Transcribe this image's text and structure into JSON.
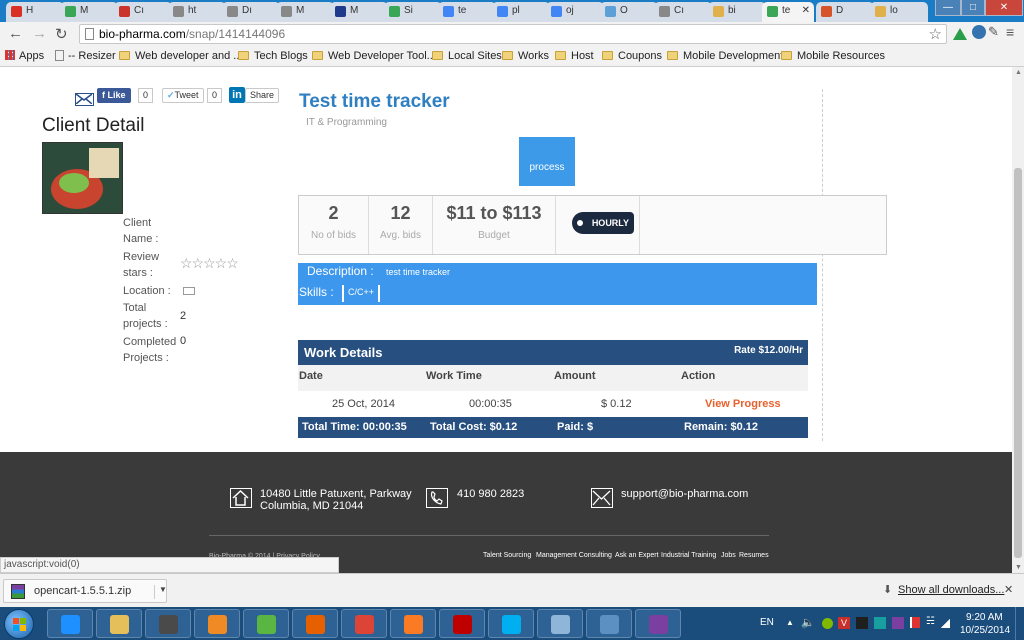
{
  "browser": {
    "tabs": [
      {
        "label": "H",
        "color": "#d93025"
      },
      {
        "label": "M",
        "color": "#3aa757"
      },
      {
        "label": "Cı",
        "color": "#c9332c"
      },
      {
        "label": "ht",
        "color": "#888888"
      },
      {
        "label": "Dı",
        "color": "#888888"
      },
      {
        "label": "M",
        "color": "#888888"
      },
      {
        "label": "M",
        "color": "#1f3a8a"
      },
      {
        "label": "Si",
        "color": "#3aa757"
      },
      {
        "label": "te",
        "color": "#4285f4"
      },
      {
        "label": "pl",
        "color": "#4285f4"
      },
      {
        "label": "oj",
        "color": "#4285f4"
      },
      {
        "label": "O",
        "color": "#5da0d8"
      },
      {
        "label": "Cı",
        "color": "#888888"
      },
      {
        "label": "bi",
        "color": "#e0b14a"
      },
      {
        "label": "te",
        "color": "#3aa757"
      },
      {
        "label": "D",
        "color": "#d7542a"
      },
      {
        "label": "lo",
        "color": "#e0b14a"
      }
    ],
    "active_tab": 14,
    "url_host": "bio-pharma.com",
    "url_path": "/snap/1414144096",
    "bookmarks": [
      "Apps",
      "-- Resizer",
      "Web developer and ...",
      "Tech Blogs",
      "Web Developer Tool...",
      "Local Sites",
      "Works",
      "Host",
      "Coupons",
      "Mobile Development",
      "Mobile Resources"
    ]
  },
  "share": {
    "like": "Like",
    "like_count": "0",
    "tweet": "Tweet",
    "tweet_count": "0",
    "linkedin": "Share",
    "linkedin_logo": "in"
  },
  "client": {
    "heading": "Client Detail",
    "name_label_1": "Client",
    "name_label_2": "Name :",
    "review_label_1": "Review",
    "review_label_2": "stars :",
    "stars": "☆☆☆☆☆",
    "location_label": "Location :",
    "projects_label_1": "Total",
    "projects_label_2": "projects :",
    "projects_value": "2",
    "completed_label_1": "Completed",
    "completed_label_2": "Projects :",
    "completed_value": "0"
  },
  "project": {
    "title": "Test time tracker",
    "category": "IT & Programming",
    "status_button": "process",
    "bids": "2",
    "bids_caption": "No of bids",
    "avg_bids": "12",
    "avg_caption": "Avg. bids",
    "budget": "$11 to $113",
    "budget_caption": "Budget",
    "tag": "HOURLY",
    "description_label": "Description :",
    "description_value": "test time tracker",
    "skills_label": "Skills :",
    "skill": "C/C++"
  },
  "work": {
    "title": "Work Details",
    "rate": "Rate $12.00/Hr",
    "columns": [
      "Date",
      "Work Time",
      "Amount",
      "Action"
    ],
    "row": {
      "date": "25 Oct, 2014",
      "time": "00:00:35",
      "amount": "$ 0.12",
      "action": "View Progress"
    },
    "total_time": "Total Time: 00:00:35",
    "total_cost": "Total Cost: $0.12",
    "paid": "Paid: $",
    "remain": "Remain: $0.12"
  },
  "footer": {
    "address_1": "10480 Little Patuxent, Parkway",
    "address_2": "Columbia, MD 21044",
    "phone": "410 980 2823",
    "email": "support@bio-pharma.com",
    "copyright": "Bio-Pharma © 2014  |  Privacy Policy",
    "links": [
      "Talent Sourcing",
      "Management Consulting",
      "Ask an Expert",
      "Industrial Training",
      "Jobs",
      "Resumes"
    ]
  },
  "status_url": "javascript:void(0)",
  "downloads": {
    "file": "opencart-1.5.5.1.zip",
    "show_all": "Show all downloads...",
    "close": "✕"
  },
  "taskbar": {
    "lang": "EN",
    "time": "9:20 AM",
    "date": "10/25/2014",
    "apps": [
      {
        "icon": "internet-explorer-icon",
        "color": "#1e90ff"
      },
      {
        "icon": "file-explorer-icon",
        "color": "#e5c05a"
      },
      {
        "icon": "sublime-text-icon",
        "color": "#4a4a4a"
      },
      {
        "icon": "media-player-icon",
        "color": "#f08a24"
      },
      {
        "icon": "messenger-icon",
        "color": "#5bb543"
      },
      {
        "icon": "firefox-icon",
        "color": "#e66000"
      },
      {
        "icon": "chrome-icon",
        "color": "#db4437"
      },
      {
        "icon": "xampp-icon",
        "color": "#fb7a24"
      },
      {
        "icon": "filezilla-icon",
        "color": "#bf0000"
      },
      {
        "icon": "skype-icon",
        "color": "#00aff0"
      },
      {
        "icon": "notepad-icon",
        "color": "#8fb5d8"
      },
      {
        "icon": "network-tool-icon",
        "color": "#5c8fc2"
      },
      {
        "icon": "winrar-icon",
        "color": "#7a3fa0"
      }
    ]
  }
}
